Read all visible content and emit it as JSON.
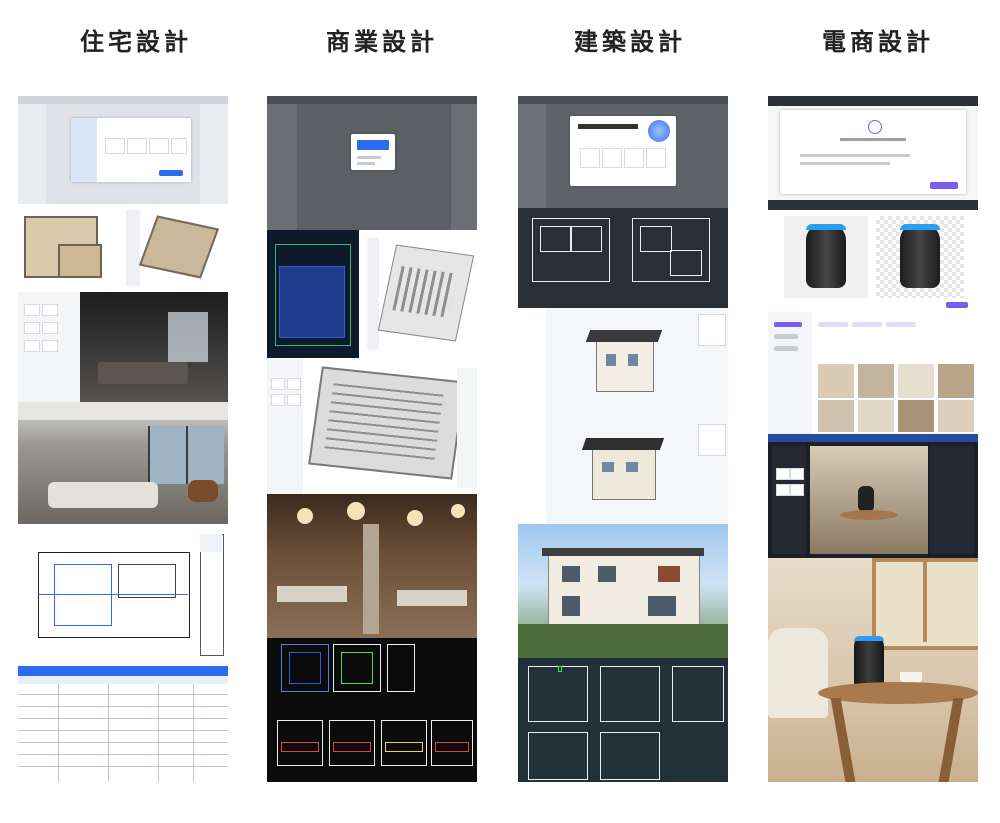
{
  "columns": [
    {
      "key": "residential",
      "title": "住宅設計"
    },
    {
      "key": "commercial",
      "title": "商業設計"
    },
    {
      "key": "architecture",
      "title": "建築設計"
    },
    {
      "key": "ecommerce",
      "title": "電商設計"
    }
  ],
  "colors": {
    "title_text": "#222222",
    "dark_ui": "#2b2f36",
    "cad_background": "#111418",
    "accent_blue": "#2b6cf0",
    "accent_purple": "#7b5cf0"
  },
  "icons": [
    "sofa-icon",
    "bed-icon",
    "table-icon",
    "speaker-icon",
    "window-icon"
  ]
}
